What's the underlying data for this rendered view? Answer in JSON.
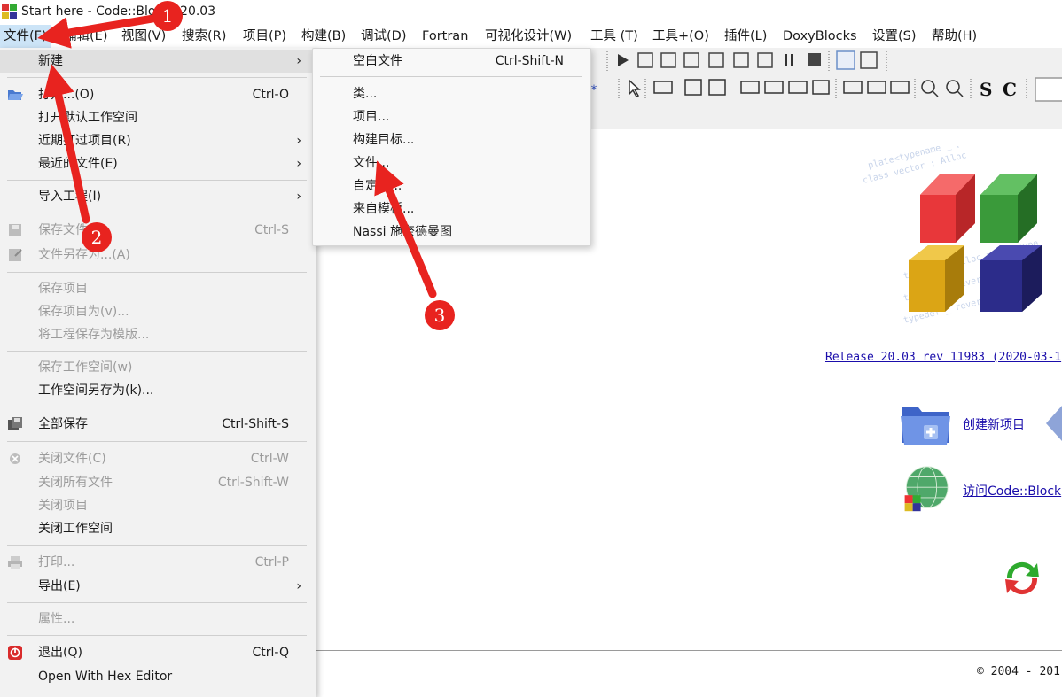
{
  "window": {
    "title": "Start here - Code::Blocks 20.03"
  },
  "menubar": {
    "items": [
      {
        "label": "文件(F)"
      },
      {
        "label": "编辑(E)"
      },
      {
        "label": "视图(V)"
      },
      {
        "label": "搜索(R)"
      },
      {
        "label": "项目(P)"
      },
      {
        "label": "构建(B)"
      },
      {
        "label": "调试(D)"
      },
      {
        "label": "Fortran"
      },
      {
        "label": "可视化设计(W)"
      },
      {
        "label": "工具 (T)"
      },
      {
        "label": "工具+(O)"
      },
      {
        "label": "插件(L)"
      },
      {
        "label": "DoxyBlocks"
      },
      {
        "label": "设置(S)"
      },
      {
        "label": "帮助(H)"
      }
    ]
  },
  "file_menu": {
    "items": [
      {
        "label": "新建",
        "shortcut": "",
        "submenu": true,
        "enabled": true
      },
      {
        "label": "打开...(O)",
        "shortcut": "Ctrl-O",
        "enabled": true
      },
      {
        "label": "打开默认工作空间",
        "shortcut": "",
        "enabled": true
      },
      {
        "label": "近期打过项目(R)",
        "shortcut": "",
        "submenu": true,
        "enabled": true
      },
      {
        "label": "最近的文件(E)",
        "shortcut": "",
        "submenu": true,
        "enabled": true
      },
      {
        "label": "导入工程(I)",
        "shortcut": "",
        "submenu": true,
        "enabled": true
      },
      {
        "label": "保存文件",
        "shortcut": "Ctrl-S",
        "enabled": false
      },
      {
        "label": "文件另存为...(A)",
        "shortcut": "",
        "enabled": false
      },
      {
        "label": "保存项目",
        "shortcut": "",
        "enabled": false
      },
      {
        "label": "保存项目为(v)...",
        "shortcut": "",
        "enabled": false
      },
      {
        "label": "将工程保存为模版...",
        "shortcut": "",
        "enabled": false
      },
      {
        "label": "保存工作空间(w)",
        "shortcut": "",
        "enabled": false
      },
      {
        "label": "工作空间另存为(k)...",
        "shortcut": "",
        "enabled": true
      },
      {
        "label": "全部保存",
        "shortcut": "Ctrl-Shift-S",
        "enabled": true
      },
      {
        "label": "关闭文件(C)",
        "shortcut": "Ctrl-W",
        "enabled": false
      },
      {
        "label": "关闭所有文件",
        "shortcut": "Ctrl-Shift-W",
        "enabled": false
      },
      {
        "label": "关闭项目",
        "shortcut": "",
        "enabled": false
      },
      {
        "label": "关闭工作空间",
        "shortcut": "",
        "enabled": true
      },
      {
        "label": "打印...",
        "shortcut": "Ctrl-P",
        "enabled": false
      },
      {
        "label": "导出(E)",
        "shortcut": "",
        "submenu": true,
        "enabled": true
      },
      {
        "label": "属性...",
        "shortcut": "",
        "enabled": false
      },
      {
        "label": "退出(Q)",
        "shortcut": "Ctrl-Q",
        "enabled": true
      },
      {
        "label": "Open With Hex Editor",
        "shortcut": "",
        "enabled": true
      }
    ]
  },
  "new_submenu": {
    "items": [
      {
        "label": "空白文件",
        "shortcut": "Ctrl-Shift-N"
      },
      {
        "label": "类..."
      },
      {
        "label": "项目..."
      },
      {
        "label": "构建目标..."
      },
      {
        "label": "文件..."
      },
      {
        "label": "自定义..."
      },
      {
        "label": "来自模板..."
      },
      {
        "label": "Nassi 施奈德曼图"
      }
    ]
  },
  "start_page": {
    "release": "Release 20.03 rev 11983 (2020-03-1",
    "create_project": "创建新项目",
    "visit_site": "访问Code::Block",
    "copyright": "© 2004 - 201"
  },
  "toolbar": {
    "wildcard_label": ".*"
  },
  "annotations": {
    "step1": "1",
    "step2": "2",
    "step3": "3",
    "color": "#e8231f"
  }
}
